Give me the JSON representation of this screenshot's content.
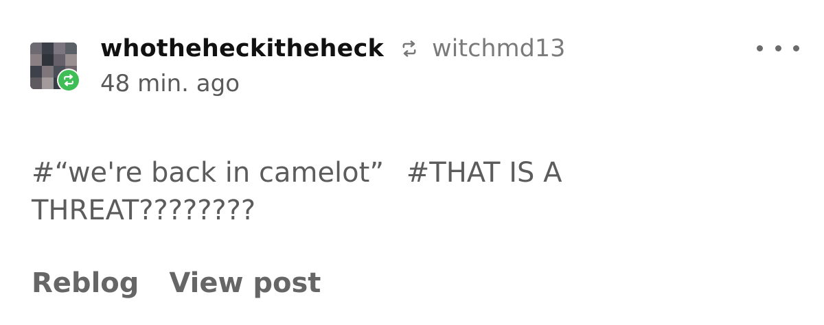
{
  "post": {
    "blog_name": "whotheheckitheheck",
    "reblogged_from": "witchmd13",
    "timestamp": "48 min. ago",
    "tags": [
      "#“we're back in camelot”",
      "#THAT IS A THREAT????????"
    ],
    "actions": {
      "reblog_label": "Reblog",
      "view_post_label": "View post"
    }
  },
  "icons": {
    "reblog_badge": "reblog-icon",
    "reblog_inline": "reblog-icon",
    "more_menu": "more-horizontal-icon"
  },
  "colors": {
    "reblog_green": "#3fbe55",
    "text_primary": "#111111",
    "text_secondary": "#7a7a7a",
    "tag_text": "#5c5c5c",
    "action_text": "#666666"
  }
}
